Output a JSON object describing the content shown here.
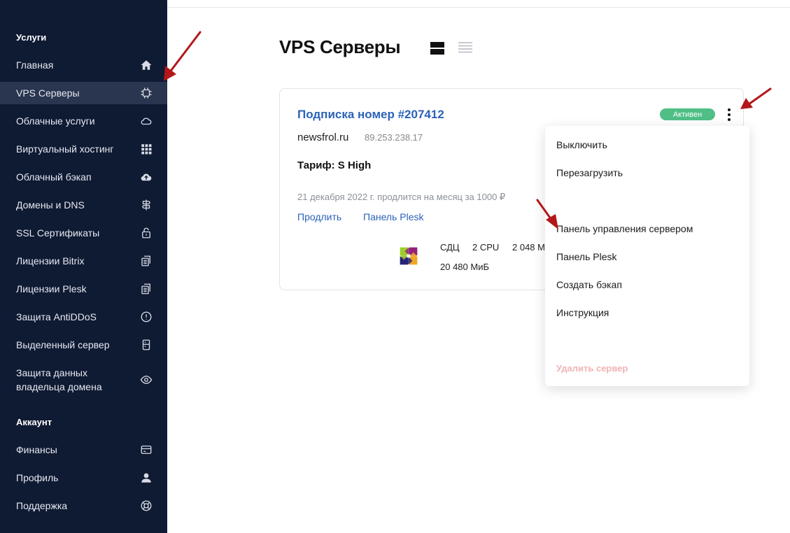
{
  "sidebar": {
    "section_services": "Услуги",
    "items": [
      {
        "label": "Главная",
        "icon": "home-icon"
      },
      {
        "label": "VPS Серверы",
        "icon": "chip-icon",
        "active": true
      },
      {
        "label": "Облачные услуги",
        "icon": "cloud-icon"
      },
      {
        "label": "Виртуальный хостинг",
        "icon": "grid-icon"
      },
      {
        "label": "Облачный бэкап",
        "icon": "cloud-upload-icon"
      },
      {
        "label": "Домены и DNS",
        "icon": "signpost-icon"
      },
      {
        "label": "SSL Сертификаты",
        "icon": "lock-icon"
      },
      {
        "label": "Лицензии Bitrix",
        "icon": "documents-icon"
      },
      {
        "label": "Лицензии Plesk",
        "icon": "documents-icon"
      },
      {
        "label": "Защита AntiDDoS",
        "icon": "alert-circle-icon"
      },
      {
        "label": "Выделенный сервер",
        "icon": "server-icon"
      },
      {
        "label": "Защита данных\nвладельца домена",
        "icon": "eye-icon"
      }
    ],
    "section_account": "Аккаунт",
    "account_items": [
      {
        "label": "Финансы",
        "icon": "credit-card-icon"
      },
      {
        "label": "Профиль",
        "icon": "user-icon"
      },
      {
        "label": "Поддержка",
        "icon": "lifebuoy-icon"
      }
    ]
  },
  "main": {
    "title": "VPS Серверы",
    "card": {
      "title": "Подписка номер #207412",
      "status": "Активен",
      "domain": "newsfrol.ru",
      "ip": "89.253.238.17",
      "tariff": "Тариф: S High",
      "renew_text": "21 декабря 2022 г. продлится на месяц за 1000 ₽",
      "renew_link": "Продлить",
      "plesk_link": "Панель Plesk",
      "specs": {
        "disk_type": "СДЦ",
        "cpu": "2 CPU",
        "ram": "2 048 М",
        "disk": "20 480 МиБ"
      }
    },
    "menu": {
      "items": [
        "Выключить",
        "Перезагрузить",
        "Панель управления сервером",
        "Панель Plesk",
        "Создать бэкап",
        "Инструкция"
      ],
      "danger_item": "Удалить сервер"
    }
  },
  "colors": {
    "sidebar_bg": "#0f1a33",
    "sidebar_active": "#2a3550",
    "link": "#2b63b8",
    "status_badge": "#4fbf86",
    "annotation_arrow": "#b3171a",
    "danger_disabled": "#f0b4b4"
  }
}
